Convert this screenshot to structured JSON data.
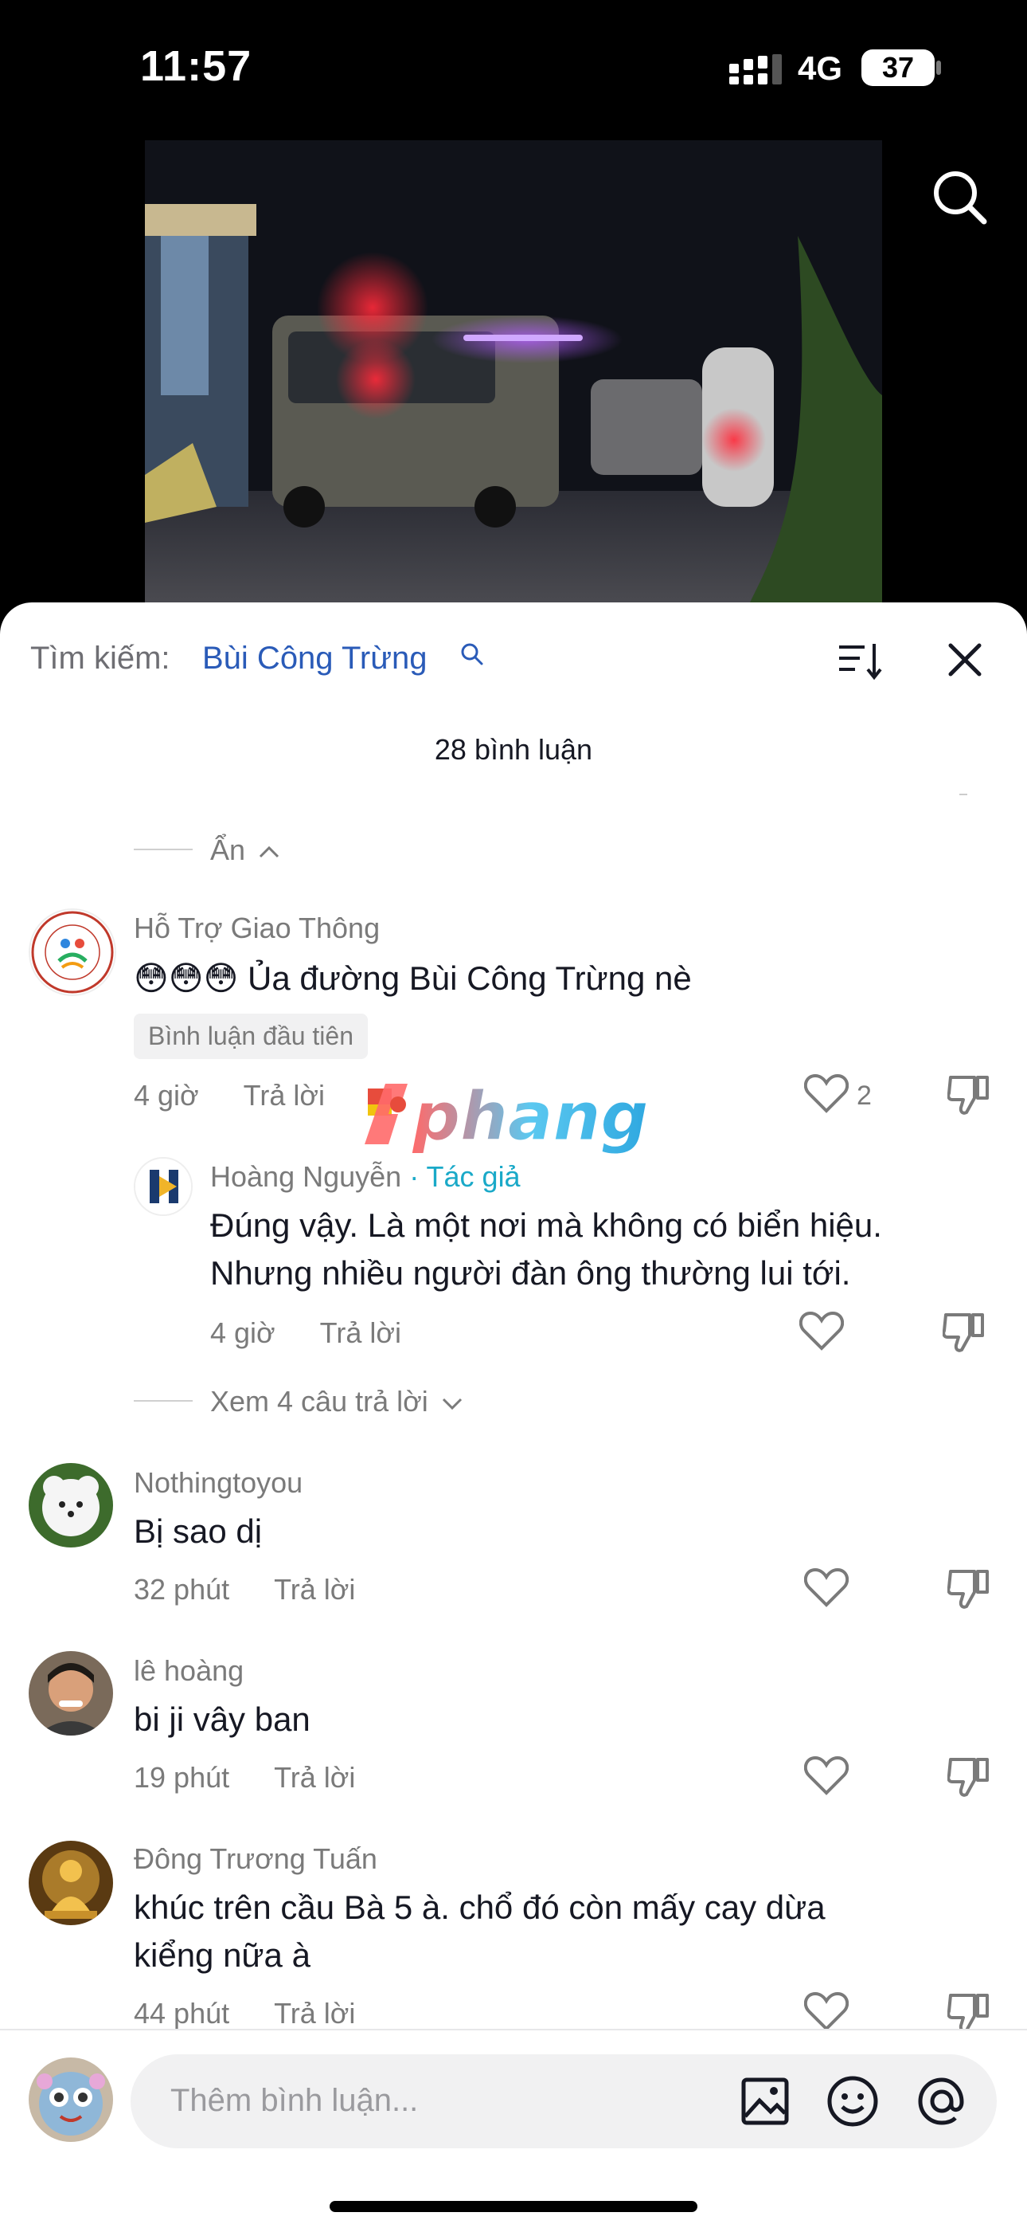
{
  "status_bar": {
    "time": "11:57",
    "network": "4G",
    "battery": "37"
  },
  "video": {
    "description_icon": "video-thumbnail"
  },
  "sheet": {
    "search_prefix": "Tìm kiếm:",
    "search_term": "Bùi Công Trừng",
    "comment_count": "28 bình luận",
    "hide_label": "Ẩn",
    "view_replies": "Xem 4 câu trả lời"
  },
  "watermark": {
    "text": "phang"
  },
  "comments": [
    {
      "username": "Hỗ Trợ Giao Thông",
      "text": "😳😳😳 Ủa đường Bùi Công Trừng nè",
      "badge": "Bình luận đầu tiên",
      "time": "4 giờ",
      "reply": "Trả lời",
      "likes": "2"
    },
    {
      "username": "Hoàng Nguyễn",
      "author_tag": "· Tác giả",
      "text_line1": "Đúng vậy. Là một nơi mà không có biển hiệu.",
      "text_line2": "Nhưng nhiều người đàn ông thường lui tới.",
      "time": "4 giờ",
      "reply": "Trả lời"
    },
    {
      "username": "Nothingtoyou",
      "text": "Bị sao dị",
      "time": "32 phút",
      "reply": "Trả lời"
    },
    {
      "username": "lê hoàng",
      "text": "bi ji vây ban",
      "time": "19 phút",
      "reply": "Trả lời"
    },
    {
      "username": "Đông Trương Tuấn",
      "text_line1": "khúc trên cầu Bà 5 à. chổ đó còn mấy cay dừa",
      "text_line2": "kiểng nữa à",
      "time": "44 phút",
      "reply": "Trả lời"
    }
  ],
  "input": {
    "placeholder": "Thêm bình luận..."
  },
  "colors": {
    "accent": "#2a5bb8",
    "author_tag": "#1aa9c8",
    "muted": "#7a7a7a",
    "text": "#161823"
  }
}
